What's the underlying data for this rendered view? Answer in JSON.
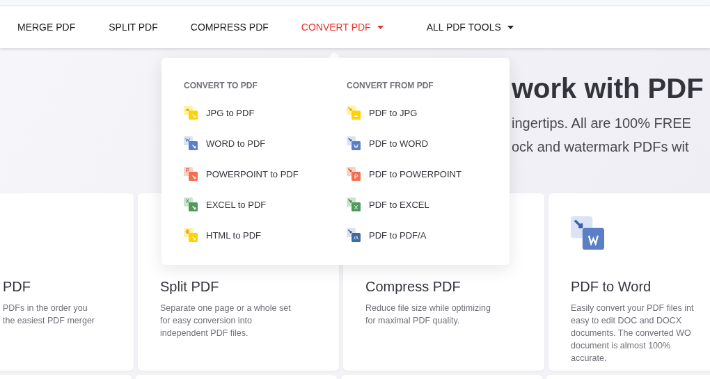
{
  "nav": [
    {
      "label": "MERGE PDF",
      "selected": false,
      "has_menu": false
    },
    {
      "label": "SPLIT PDF",
      "selected": false,
      "has_menu": false
    },
    {
      "label": "COMPRESS PDF",
      "selected": false,
      "has_menu": false
    },
    {
      "label": "CONVERT PDF",
      "selected": true,
      "has_menu": true
    },
    {
      "label": "ALL PDF TOOLS",
      "selected": false,
      "has_menu": true
    }
  ],
  "hero": {
    "title": "work with PDF",
    "lines": [
      "ingertips. All are 100% FREE",
      "ock and watermark PDFs wit"
    ]
  },
  "dropdown": {
    "columns": [
      {
        "heading": "CONVERT TO PDF",
        "kind": "to",
        "items": [
          {
            "label": "JPG to PDF",
            "kind": "image"
          },
          {
            "label": "WORD to PDF",
            "kind": "word"
          },
          {
            "label": "POWERPOINT to PDF",
            "kind": "powerpoint"
          },
          {
            "label": "EXCEL to PDF",
            "kind": "excel"
          },
          {
            "label": "HTML to PDF",
            "kind": "html"
          }
        ]
      },
      {
        "heading": "CONVERT FROM PDF",
        "kind": "from",
        "items": [
          {
            "label": "PDF to JPG",
            "kind": "image"
          },
          {
            "label": "PDF to WORD",
            "kind": "word"
          },
          {
            "label": "PDF to POWERPOINT",
            "kind": "powerpoint"
          },
          {
            "label": "PDF to EXCEL",
            "kind": "excel"
          },
          {
            "label": "PDF to PDF/A",
            "kind": "pdfa"
          }
        ]
      }
    ]
  },
  "cards": [
    {
      "title": "PDF",
      "description": [
        "PDFs in the order you",
        "the easiest PDF merger"
      ]
    },
    {
      "title": "Split PDF",
      "description": [
        "Separate one page or a whole set",
        "for easy conversion into",
        "independent PDF files."
      ]
    },
    {
      "title": "Compress PDF",
      "description": [
        "Reduce file size while optimizing",
        "for maximal PDF quality."
      ]
    },
    {
      "title": "PDF to Word",
      "kind": "word",
      "description": [
        "Easily convert your PDF files int",
        "easy to edit DOC and DOCX",
        "documents. The converted WO",
        "document is almost 100%",
        "accurate."
      ]
    }
  ]
}
